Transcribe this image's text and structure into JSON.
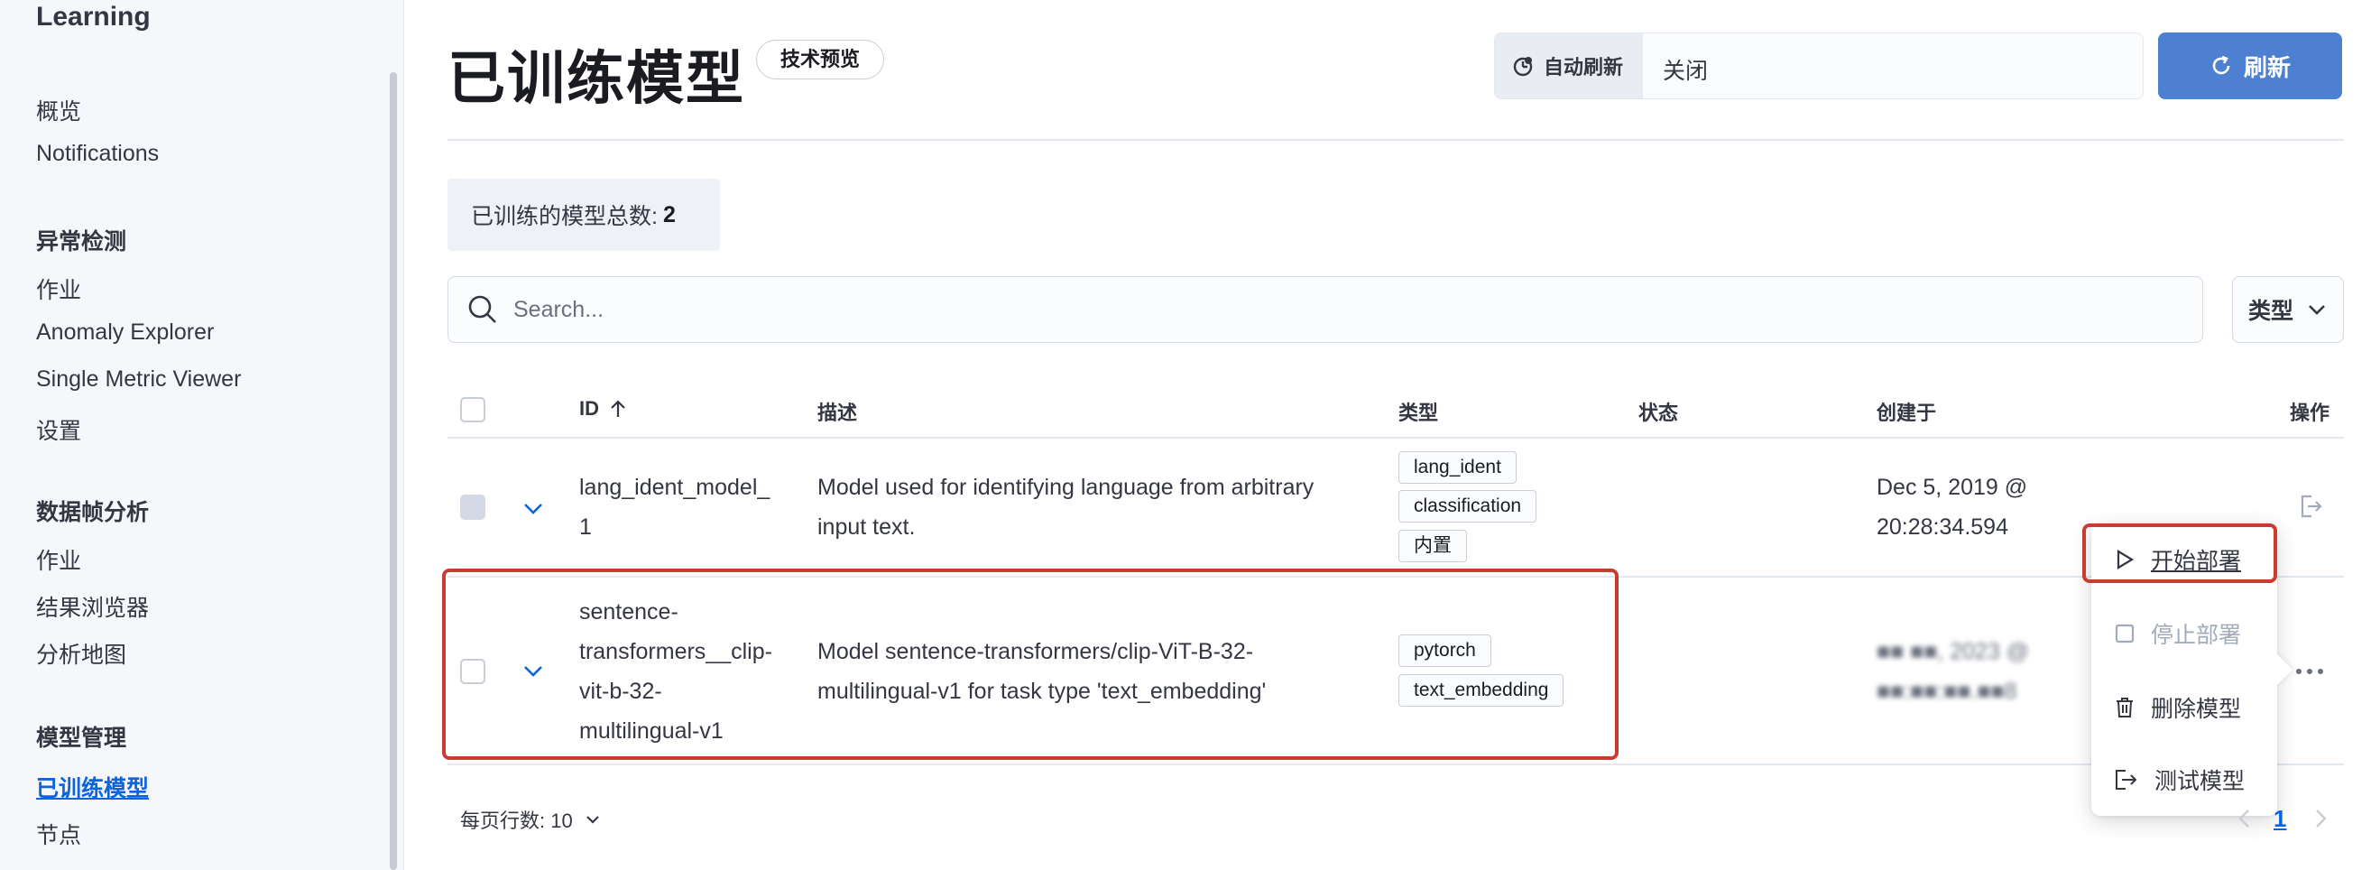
{
  "sidebar": {
    "title": "Learning",
    "items": [
      {
        "label": "概览"
      },
      {
        "label": "Notifications"
      }
    ],
    "sections": [
      {
        "heading": "异常检测",
        "items": [
          "作业",
          "Anomaly Explorer",
          "Single Metric Viewer",
          "设置"
        ]
      },
      {
        "heading": "数据帧分析",
        "items": [
          "作业",
          "结果浏览器",
          "分析地图"
        ]
      },
      {
        "heading": "模型管理",
        "items": [
          "已训练模型",
          "节点"
        ]
      }
    ]
  },
  "header": {
    "title": "已训练模型",
    "badge": "技术预览",
    "auto_refresh_label": "自动刷新",
    "auto_refresh_value": "关闭",
    "refresh_label": "刷新"
  },
  "summary": {
    "label": "已训练的模型总数:",
    "count": "2"
  },
  "search": {
    "placeholder": "Search..."
  },
  "type_filter": {
    "label": "类型"
  },
  "table": {
    "columns": {
      "id": "ID",
      "description": "描述",
      "type": "类型",
      "state": "状态",
      "created": "创建于",
      "actions": "操作"
    },
    "rows": [
      {
        "id_lines": [
          "lang_ident_model_",
          "1"
        ],
        "desc_lines": [
          "Model used for identifying language from arbitrary",
          "input text."
        ],
        "tags": [
          "lang_ident",
          "classification",
          "内置"
        ],
        "created_lines": [
          "Dec 5, 2019 @",
          "20:28:34.594"
        ]
      },
      {
        "id_lines": [
          "sentence-",
          "transformers__clip-",
          "vit-b-32-",
          "multilingual-v1"
        ],
        "desc_lines": [
          "Model sentence-transformers/clip-ViT-B-32-",
          "multilingual-v1 for task type 'text_embedding'"
        ],
        "tags": [
          "pytorch",
          "text_embedding"
        ],
        "created_lines": [
          "■■ ■■, 2023 @",
          "■■:■■:■■.■■8"
        ]
      }
    ]
  },
  "actions_menu": {
    "items": [
      "开始部署",
      "停止部署",
      "删除模型",
      "测试模型"
    ]
  },
  "footer": {
    "rows_per_page": "每页行数: 10",
    "page": "1"
  },
  "colors": {
    "accent": "#0b64dd",
    "refresh_button": "#4d80d1",
    "highlight": "#c83d30"
  }
}
